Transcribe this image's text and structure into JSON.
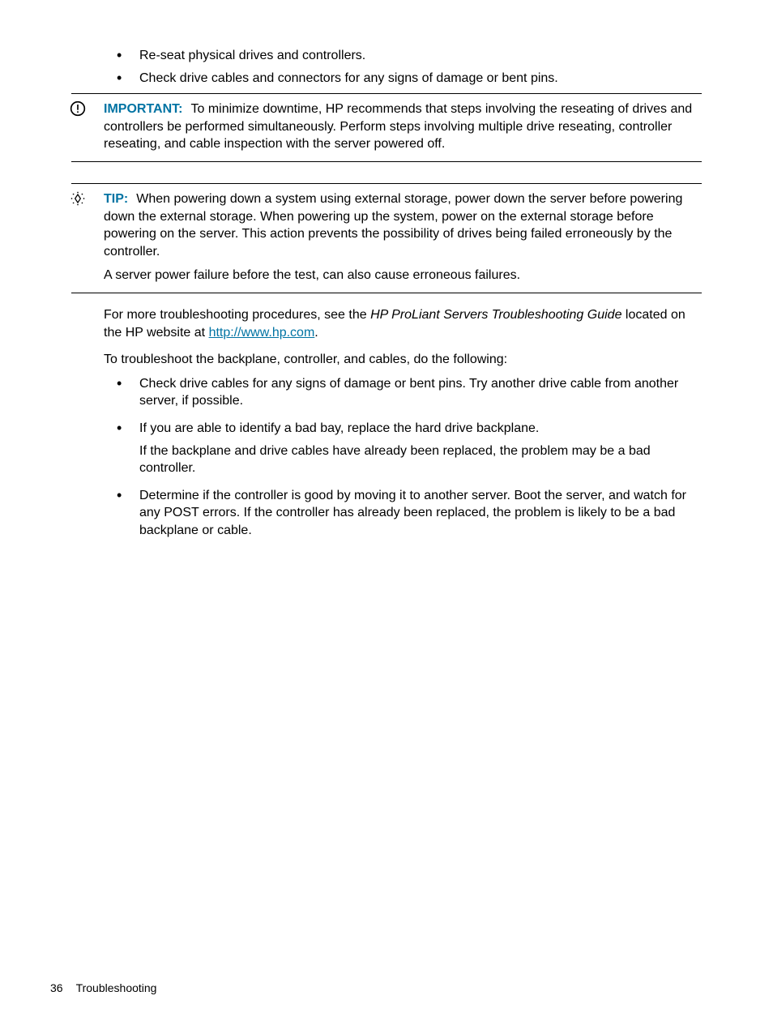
{
  "top_bullets": [
    "Re-seat physical drives and controllers.",
    "Check drive cables and connectors for any signs of damage or bent pins."
  ],
  "important": {
    "label": "IMPORTANT:",
    "text": "To minimize downtime, HP recommends that steps involving the reseating of drives and controllers be performed simultaneously. Perform steps involving multiple drive reseating, controller reseating, and cable inspection with the server powered off."
  },
  "tip": {
    "label": "TIP:",
    "text": "When powering down a system using external storage, power down the server before powering down the external storage. When powering up the system, power on the external storage before powering on the server. This action prevents the possibility of drives being failed erroneously by the controller.",
    "extra": "A server power failure before the test, can also cause erroneous failures."
  },
  "more_proc": {
    "pre": "For more troubleshooting procedures, see the ",
    "italic": "HP ProLiant Servers Troubleshooting Guide",
    "mid": " located on the HP website at ",
    "link": "http://www.hp.com",
    "post": "."
  },
  "intro2": "To troubleshoot the backplane, controller, and cables, do the following:",
  "steps": [
    {
      "text": "Check drive cables for any signs of damage or bent pins. Try another drive cable from another server, if possible."
    },
    {
      "text": "If you are able to identify a bad bay, replace the hard drive backplane.",
      "sub": "If the backplane and drive cables have already been replaced, the problem may be a bad controller."
    },
    {
      "text": "Determine if the controller is good by moving it to another server. Boot the server, and watch for any POST errors. If the controller has already been replaced, the problem is likely to be a bad backplane or cable."
    }
  ],
  "footer": {
    "page": "36",
    "section": "Troubleshooting"
  }
}
